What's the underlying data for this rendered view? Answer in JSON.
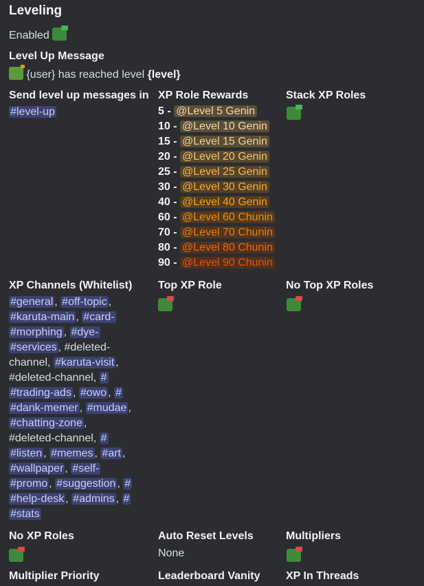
{
  "leveling": {
    "title": "Leveling"
  },
  "enabled": {
    "text": "Enabled"
  },
  "level_up_message": {
    "heading": "Level Up Message",
    "text": "{user} has reached level",
    "bold": "{level}"
  },
  "send_channel": {
    "heading": "Send level up messages in",
    "channel": "level-up"
  },
  "xp_role_rewards": {
    "heading": "XP Role Rewards",
    "items": [
      {
        "level": "5 -",
        "role": "@Level 5 Genin",
        "color": "#f3d9a4",
        "bg": "#5a4e3a"
      },
      {
        "level": "10 -",
        "role": "@Level 10 Genin",
        "color": "#f3d9a4",
        "bg": "#5a4e3a"
      },
      {
        "level": "15 -",
        "role": "@Level 15 Genin",
        "color": "#f0d18e",
        "bg": "#5a4d36"
      },
      {
        "level": "20 -",
        "role": "@Level 20 Genin",
        "color": "#f3c46a",
        "bg": "#58492f"
      },
      {
        "level": "25 -",
        "role": "@Level 25 Genin",
        "color": "#f4b84c",
        "bg": "#574429"
      },
      {
        "level": "30 -",
        "role": "@Level 30 Genin",
        "color": "#f3ad32",
        "bg": "#564025"
      },
      {
        "level": "40 -",
        "role": "@Level 40 Genin",
        "color": "#f0a219",
        "bg": "#553d21"
      },
      {
        "level": "60 -",
        "role": "@Level 60 Chunin",
        "color": "#ee8f10",
        "bg": "#553a20"
      },
      {
        "level": "70 -",
        "role": "@Level 70 Chunin",
        "color": "#ea7d0d",
        "bg": "#54361e"
      },
      {
        "level": "80 -",
        "role": "@Level 80 Chunin",
        "color": "#e66a0b",
        "bg": "#53321d"
      },
      {
        "level": "90 -",
        "role": "@Level 90 Chunin",
        "color": "#e0570a",
        "bg": "#522f1c"
      }
    ]
  },
  "stack_xp_roles": {
    "heading": "Stack XP Roles"
  },
  "xp_channels": {
    "heading": "XP Channels (Whitelist)",
    "lines": [
      [
        {
          "c": "general"
        },
        {
          "t": ", "
        },
        {
          "c": "off-topic"
        },
        {
          "t": ","
        }
      ],
      [
        {
          "c": "karuta-main"
        },
        {
          "t": ", "
        },
        {
          "c": "card-"
        }
      ],
      [
        {
          "c": "morphing"
        },
        {
          "t": ", "
        },
        {
          "c": "dye-"
        }
      ],
      [
        {
          "c": "services"
        },
        {
          "t": ", #deleted-"
        }
      ],
      [
        {
          "t": "channel, "
        },
        {
          "c": "karuta-visit"
        },
        {
          "t": ","
        }
      ],
      [
        {
          "t": "#deleted-channel, "
        },
        {
          "c": ""
        }
      ],
      [
        {
          "c": "trading-ads"
        },
        {
          "t": ", "
        },
        {
          "c": "owo"
        },
        {
          "t": ", "
        },
        {
          "c": ""
        }
      ],
      [
        {
          "c": "dank-memer"
        },
        {
          "t": ", "
        },
        {
          "c": "mudae"
        },
        {
          "t": ","
        }
      ],
      [
        {
          "c": "chatting-zone"
        },
        {
          "t": ","
        }
      ],
      [
        {
          "t": "#deleted-channel, "
        },
        {
          "c": ""
        }
      ],
      [
        {
          "c": "listen"
        },
        {
          "t": ", "
        },
        {
          "c": "memes"
        },
        {
          "t": ", "
        },
        {
          "c": "art"
        },
        {
          "t": ","
        }
      ],
      [
        {
          "c": "wallpaper"
        },
        {
          "t": ", "
        },
        {
          "c": "self-"
        }
      ],
      [
        {
          "c": "promo"
        },
        {
          "t": ", "
        },
        {
          "c": "suggestion"
        },
        {
          "t": ", "
        },
        {
          "c": ""
        }
      ],
      [
        {
          "c": "help-desk"
        },
        {
          "t": ", "
        },
        {
          "c": "admins"
        },
        {
          "t": ", "
        },
        {
          "c": ""
        }
      ],
      [
        {
          "c": "stats"
        }
      ]
    ]
  },
  "top_xp_role": {
    "heading": "Top XP Role"
  },
  "no_top_xp_roles": {
    "heading": "No Top XP Roles"
  },
  "no_xp_roles": {
    "heading": "No XP Roles"
  },
  "auto_reset_levels": {
    "heading": "Auto Reset Levels",
    "value": "None"
  },
  "multipliers": {
    "heading": "Multipliers"
  },
  "multiplier_priority": {
    "heading": "Multiplier Priority"
  },
  "leaderboard_vanity": {
    "heading": "Leaderboard Vanity"
  },
  "xp_in_threads": {
    "heading": "XP In Threads"
  },
  "icons": {
    "hash": "#"
  }
}
